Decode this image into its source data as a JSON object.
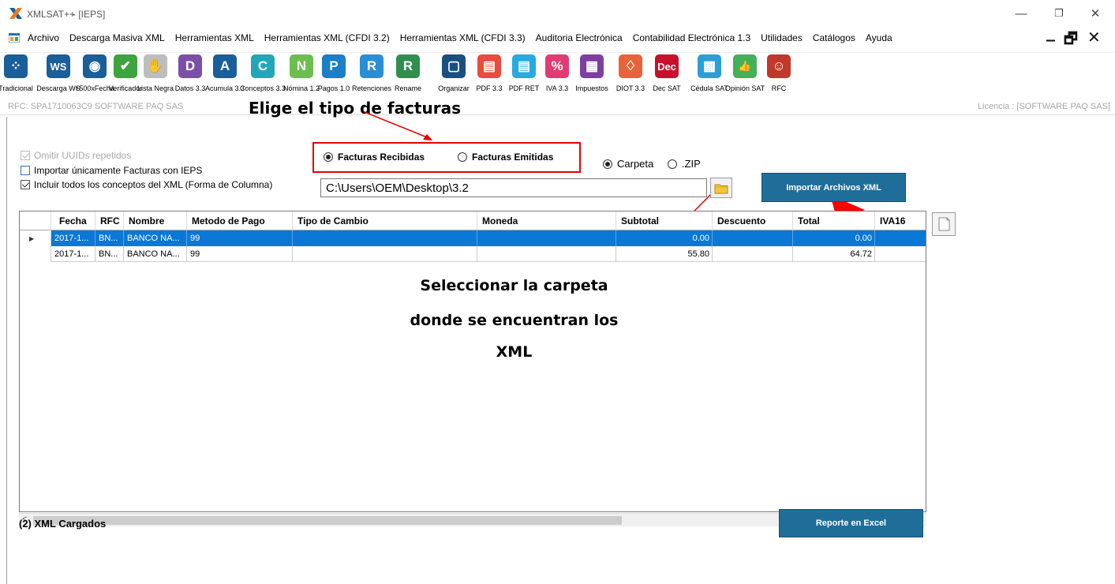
{
  "window": {
    "app_title": "XMLSAT++",
    "doc_title": "- [IEPS]",
    "minimize": "—",
    "restore": "❐",
    "close": "✕"
  },
  "menu": {
    "items": [
      "Archivo",
      "Descarga Masiva XML",
      "Herramientas XML",
      "Herramientas XML (CFDI 3.2)",
      "Herramientas XML (CFDI 3.3)",
      "Auditoria Electrónica",
      "Contabilidad Electrónica 1.3",
      "Utilidades",
      "Catálogos",
      "Ayuda"
    ],
    "mdi_minimize": "_",
    "mdi_restore": "🗗",
    "mdi_close": "✕"
  },
  "toolbar": {
    "items": [
      {
        "label": "Tradicional",
        "icon": "grid-icon",
        "color": "#1a5e9a",
        "glyph": "⁘"
      },
      {
        "label": "Descarga WS",
        "icon": "ws-icon",
        "color": "#1a5e9a",
        "glyph": "WS"
      },
      {
        "label": "+500xFecha",
        "icon": "pill-icon",
        "color": "#1a5e9a",
        "glyph": "◉"
      },
      {
        "label": "Verificador",
        "icon": "check-icon",
        "color": "#3fa33f",
        "glyph": "✔"
      },
      {
        "label": "Lista Negra",
        "icon": "hand-icon",
        "color": "#bdbdbd",
        "glyph": "✋"
      },
      {
        "label": "Datos 3.3",
        "icon": "d-icon",
        "color": "#7b4fa8",
        "glyph": "D"
      },
      {
        "label": "Acumula 3.3",
        "icon": "a-icon",
        "color": "#1a5e9a",
        "glyph": "A"
      },
      {
        "label": "Conceptos 3.3",
        "icon": "c-icon",
        "color": "#22a7b8",
        "glyph": "C"
      },
      {
        "label": "Nómina 1.2",
        "icon": "n-icon",
        "color": "#6cbf4f",
        "glyph": "N"
      },
      {
        "label": "Pagos 1.0",
        "icon": "p-icon",
        "color": "#1a7fc4",
        "glyph": "P"
      },
      {
        "label": "Retenciones",
        "icon": "r-icon",
        "color": "#2a8ed6",
        "glyph": "R"
      },
      {
        "label": "Rename",
        "icon": "rename-icon",
        "color": "#2f8f4f",
        "glyph": "R"
      },
      {
        "label": "Organizar",
        "icon": "organize-icon",
        "color": "#1a4f80",
        "glyph": "▢"
      },
      {
        "label": "PDF 3.3",
        "icon": "pdf-icon",
        "color": "#e74c3c",
        "glyph": "▤"
      },
      {
        "label": "PDF RET",
        "icon": "pdf-ret-icon",
        "color": "#27a9e1",
        "glyph": "▤"
      },
      {
        "label": "IVA 3.3",
        "icon": "percent-icon",
        "color": "#e23b73",
        "glyph": "%"
      },
      {
        "label": "Impuestos",
        "icon": "calculator-icon",
        "color": "#7d3fa0",
        "glyph": "▦"
      },
      {
        "label": "DIOT 3.3",
        "icon": "handshake-icon",
        "color": "#e8623a",
        "glyph": "♢"
      },
      {
        "label": "Dec SAT",
        "icon": "dec-icon",
        "color": "#c8102e",
        "glyph": "Dec"
      },
      {
        "label": "Cédula SAT",
        "icon": "qr-icon",
        "color": "#2a9fd6",
        "glyph": "▩"
      },
      {
        "label": "Opinión SAT",
        "icon": "thumbs-up-icon",
        "color": "#44b05a",
        "glyph": "👍"
      },
      {
        "label": "RFC",
        "icon": "person-icon",
        "color": "#c0392b",
        "glyph": "☺"
      }
    ]
  },
  "status": {
    "rfc": "RFC: SPA1710063C9 SOFTWARE PAQ SAS",
    "license": "Licencia : [SOFTWARE PAQ SAS]"
  },
  "annotations": {
    "title": "Elige el tipo de facturas",
    "note_lines": [
      "Seleccionar la carpeta",
      "donde se encuentran los",
      "XML"
    ],
    "arrow_color": "#e60000"
  },
  "options": {
    "omit_uuids": "Omitir UUIDs repetidos",
    "ieps_only": "Importar únicamente  Facturas con IEPS",
    "include_concepts": "Incluir todos los conceptos  del XML (Forma de Columna)"
  },
  "invoice_type": {
    "received": "Facturas Recibidas",
    "issued": "Facturas Emitidas"
  },
  "source": {
    "folder": "Carpeta",
    "zip": ".ZIP",
    "path": "C:\\Users\\OEM\\Desktop\\3.2"
  },
  "buttons": {
    "import": "Importar Archivos  XML",
    "export": "Reporte en Excel"
  },
  "grid": {
    "columns": [
      "Fecha",
      "RFC",
      "Nombre",
      "Metodo de Pago",
      "Tipo de Cambio",
      "Moneda",
      "Subtotal",
      "Descuento",
      "Total",
      "IVA16"
    ],
    "rows": [
      {
        "fecha": "2017-1...",
        "rfc": "BN...",
        "nombre": "BANCO NA...",
        "metodo": "99",
        "tipo": "",
        "moneda": "",
        "subtotal": "0.00",
        "descuento": "",
        "total": "0.00",
        "iva16": ""
      },
      {
        "fecha": "2017-1...",
        "rfc": "BN...",
        "nombre": "BANCO NA...",
        "metodo": "99",
        "tipo": "",
        "moneda": "",
        "subtotal": "55.80",
        "descuento": "",
        "total": "64.72",
        "iva16": ""
      }
    ],
    "row_marker": "▶"
  },
  "footer": {
    "loaded": "(2) XML Cargados"
  }
}
